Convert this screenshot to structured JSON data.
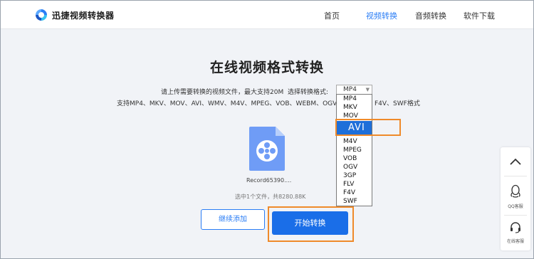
{
  "app": {
    "logo_text": "迅捷视频转换器"
  },
  "nav": {
    "home": "首页",
    "video": "视频转换",
    "audio": "音频转换",
    "download": "软件下载"
  },
  "main": {
    "title": "在线视频格式转换",
    "upload_hint": "请上传需要转换的视频文件，最大支持20M",
    "select_label": "选择转换格式:",
    "supported_prefix": "支持MP4、MKV、MOV、AVI、WMV、M4V、MPEG、VOB、WEBM、OGV、",
    "supported_suffix": "F4V、SWF格式"
  },
  "format_select": {
    "value": "MP4",
    "options": [
      "MP4",
      "MKV",
      "MOV",
      "AVI",
      "M4V",
      "MPEG",
      "VOB",
      "OGV",
      "3GP",
      "FLV",
      "F4V",
      "SWF"
    ],
    "highlighted": "AVI"
  },
  "file": {
    "name": "Record65390....",
    "summary": "选中1个文件，共8280.88K"
  },
  "buttons": {
    "add_more": "继续添加",
    "start": "开始转换"
  },
  "sidebar": {
    "qq_label": "QQ客服",
    "online_label": "在线客服"
  },
  "colors": {
    "accent": "#2a7df5",
    "primary_button": "#1a6ee8",
    "highlight_box": "#ef8a2a",
    "selected_option": "#1e6fd9"
  }
}
